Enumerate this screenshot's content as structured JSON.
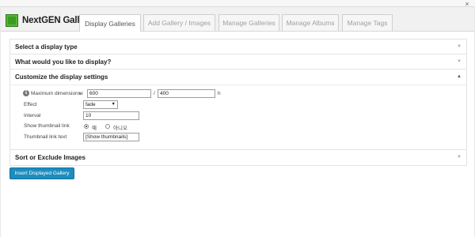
{
  "header": {
    "logo_text": "NextGEN Gallery",
    "tabs": [
      {
        "label": "Display Galleries",
        "active": true
      },
      {
        "label": "Add Gallery / Images",
        "active": false
      },
      {
        "label": "Manage Galleries",
        "active": false
      },
      {
        "label": "Manage Albums",
        "active": false
      },
      {
        "label": "Manage Tags",
        "active": false
      }
    ]
  },
  "close_label": "×",
  "sections": {
    "display_type": {
      "title": "Select a display type",
      "expanded": false
    },
    "what_display": {
      "title": "What would you like to display?",
      "expanded": false
    },
    "customize": {
      "title": "Customize the display settings",
      "expanded": true
    },
    "sort_exclude": {
      "title": "Sort or Exclude Images",
      "expanded": false
    }
  },
  "settings": {
    "max_dimensions": {
      "label": "Maximum dimensions",
      "w_label": "w",
      "width_value": "600",
      "separator": "/",
      "height_value": "400",
      "h_label": "h"
    },
    "effect": {
      "label": "Effect",
      "value": "fade"
    },
    "interval": {
      "label": "Interval",
      "value": "10"
    },
    "show_thumbnail_link": {
      "label": "Show thumbnail link",
      "yes_label": "예",
      "no_label": "아니오",
      "selected": "yes"
    },
    "thumbnail_link_text": {
      "label": "Thumbnail link text",
      "value": "[Show thumbnails]"
    }
  },
  "insert_button": "Insert Displayed Gallery",
  "icons": {
    "info": "info-icon",
    "collapsed_arrow": "arrow-down-icon",
    "expanded_arrow": "arrow-up-icon",
    "select_arrow": "chevron-down-icon"
  },
  "colors": {
    "primary_button": "#1e8cbe",
    "logo_green": "#3b9b22"
  }
}
